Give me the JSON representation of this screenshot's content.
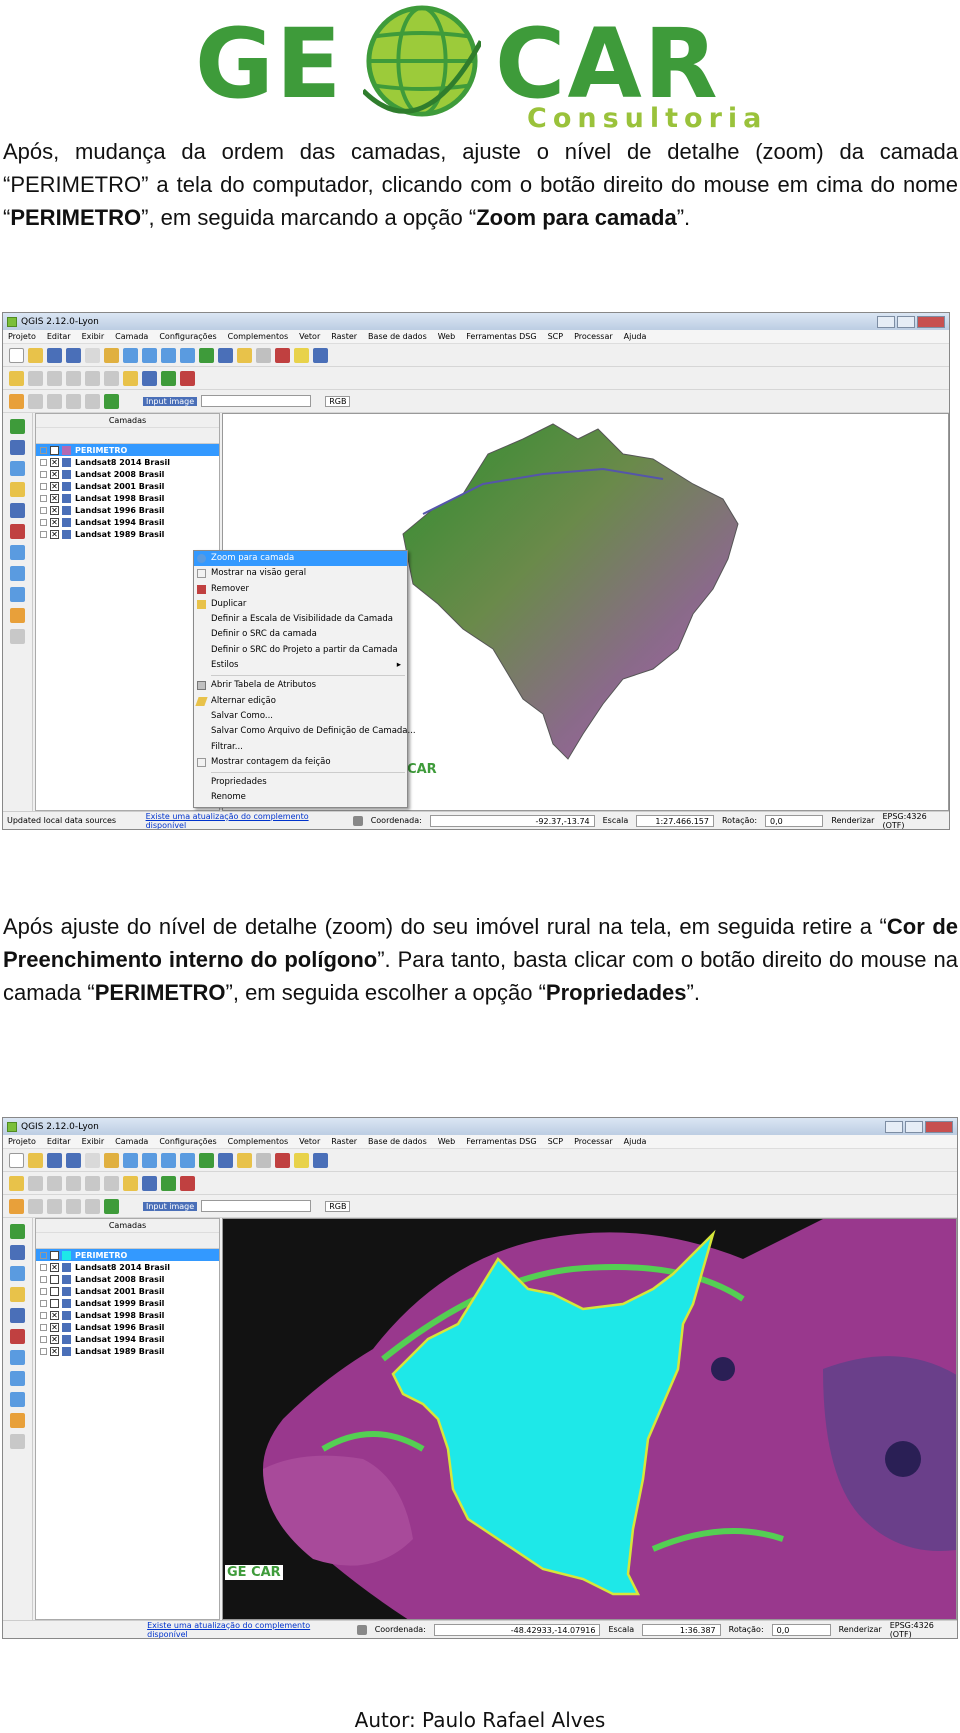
{
  "logo": {
    "left_text": "GE",
    "right_text": "CAR",
    "subtitle": "Consultoria"
  },
  "para1": {
    "t1": "Após, mudança da ordem das camadas, ajuste o nível de detalhe (zoom) da camada “PERIMETRO” a tela do computador, clicando com o botão direito do mouse em cima do nome “",
    "b1": "PERIMETRO",
    "t2": "”, em seguida marcando a opção “",
    "b2": "Zoom para camada",
    "t3": "”."
  },
  "para2": {
    "t1": "Após ajuste do nível de detalhe (zoom) do seu imóvel rural na tela, em seguida retire a “",
    "b1": "Cor de Preenchimento interno do polígono",
    "t2": "”. Para tanto, basta clicar com o botão direito do mouse na camada “",
    "b2": "PERIMETRO",
    "t3": "”, em seguida escolher a opção “",
    "b3": "Propriedades",
    "t4": "”."
  },
  "qgis": {
    "window_title": "QGIS 2.12.0-Lyon",
    "menu": [
      "Projeto",
      "Editar",
      "Exibir",
      "Camada",
      "Configurações",
      "Complementos",
      "Vetor",
      "Raster",
      "Base de dados",
      "Web",
      "Ferramentas DSG",
      "SCP",
      "Processar",
      "Ajuda"
    ],
    "layers_title": "Camadas",
    "input_image_label": "Input image",
    "rgb_label": "RGB",
    "status_message": "Updated local data sources",
    "status_link": "Existe uma atualização do complemento disponível",
    "coord_label": "Coordenada:",
    "scale_label": "Escala",
    "rotation_label": "Rotação:",
    "rotation_value": "0,0",
    "render_label": "Renderizar",
    "crs_label": "EPSG:4326 (OTF)",
    "watermark": "GE CAR"
  },
  "shot1": {
    "layers": [
      "PERIMETRO",
      "Landsat8 2014 Brasil",
      "Landsat 2008 Brasil",
      "Landsat 2001 Brasil",
      "Landsat 1998 Brasil",
      "Landsat 1996 Brasil",
      "Landsat 1994 Brasil",
      "Landsat 1989 Brasil"
    ],
    "coord_value": "-92.37,-13.74",
    "scale_value": "1:27.466.157",
    "context_menu": [
      "Zoom para camada",
      "Mostrar na visão geral",
      "Remover",
      "Duplicar",
      "Definir a Escala de Visibilidade da Camada",
      "Definir o SRC da camada",
      "Definir o SRC do Projeto a partir da Camada",
      "Estilos",
      "Abrir Tabela de Atributos",
      "Alternar edição",
      "Salvar Como...",
      "Salvar Como Arquivo de Definição de Camada...",
      "Filtrar...",
      "Mostrar contagem da feição",
      "Propriedades",
      "Renome"
    ]
  },
  "shot2": {
    "layers": [
      "PERIMETRO",
      "Landsat8 2014 Brasil",
      "Landsat 2008 Brasil",
      "Landsat 2001 Brasil",
      "Landsat 1999 Brasil",
      "Landsat 1998 Brasil",
      "Landsat 1996 Brasil",
      "Landsat 1994 Brasil",
      "Landsat 1989 Brasil"
    ],
    "coord_value": "-48.42933,-14.07916",
    "scale_value": "1:36.387"
  },
  "author": "Autor: Paulo Rafael Alves",
  "colors": {
    "brand_green": "#3e9b3a",
    "brand_light_green": "#9ac23b",
    "selection_blue": "#3399ff",
    "polygon_fill": "#1ee8e8"
  }
}
